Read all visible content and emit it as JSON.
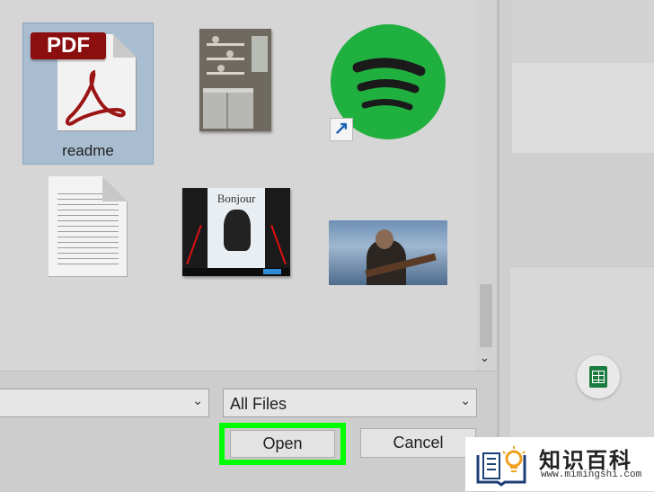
{
  "files": [
    {
      "name": "readme",
      "type": "pdf",
      "selected": true,
      "badge": "PDF"
    },
    {
      "name": "",
      "type": "image",
      "thumbnail": "kitchen-shelves"
    },
    {
      "name": "",
      "type": "shortcut",
      "thumbnail": "spotify-logo"
    },
    {
      "name": "",
      "type": "text-document"
    },
    {
      "name": "",
      "type": "image",
      "thumbnail": "bonjour-web-page",
      "thumbnail_title": "Bonjour"
    },
    {
      "name": "",
      "type": "image",
      "thumbnail": "singer-with-guitar"
    }
  ],
  "path_combo": {
    "value": ""
  },
  "filter_combo": {
    "value": "All Files"
  },
  "buttons": {
    "open": "Open",
    "cancel": "Cancel"
  },
  "watermark": {
    "title": "知识百科",
    "url": "www.mimingshi.com"
  },
  "colors": {
    "selection": "#a9bdd0",
    "highlight": "#00ff00",
    "spotify": "#20b040",
    "pdf_banner": "#8c0f0f"
  }
}
